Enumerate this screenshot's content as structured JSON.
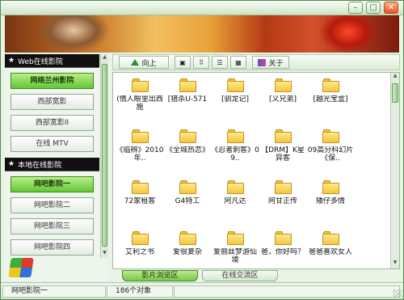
{
  "window": {
    "controls": [
      "minimize-icon",
      "maximize-icon",
      "close-icon"
    ]
  },
  "sidebar": {
    "section_web": "Web在线影院",
    "web_items": [
      {
        "label": "网络兰州影院",
        "active": true
      },
      {
        "label": "西部宽影",
        "active": false
      },
      {
        "label": "西部宽影II",
        "active": false
      },
      {
        "label": "在线 MTV",
        "active": false
      }
    ],
    "section_local": "本地在线影院",
    "local_items": [
      {
        "label": "网吧影院一",
        "active": true
      },
      {
        "label": "网吧影院二",
        "active": false
      },
      {
        "label": "网吧影院三",
        "active": false
      },
      {
        "label": "网吧影院四",
        "active": false
      }
    ]
  },
  "toolbar": {
    "up_label": "向上",
    "about_label": "关于",
    "view_icons": [
      "large-icons-icon",
      "small-icons-icon",
      "list-icon",
      "details-icon"
    ]
  },
  "files": [
    "(情人眼里出西施",
    "[猎杀U-571",
    "[驯龙记]",
    "[义兄弟]",
    "[越光宝盒]",
    "《临辨》2010年..",
    "《全城热恋》",
    "《忍者刺客》09..",
    "【DRM】K星异客",
    "09高分科幻片《保..",
    "72家租客",
    "G4特工",
    "阿凡达",
    "阿甘正传",
    "矮仔多情",
    "艾利之书",
    "爱很复杂",
    "爱丽丝梦游仙境",
    "爸，你好吗？",
    "爸爸喜欢女人"
  ],
  "tabs": [
    {
      "label": "影片浏览区",
      "active": true
    },
    {
      "label": "在线交流区",
      "active": false
    }
  ],
  "status": {
    "location": "网吧影院一",
    "count": "186个对象"
  }
}
